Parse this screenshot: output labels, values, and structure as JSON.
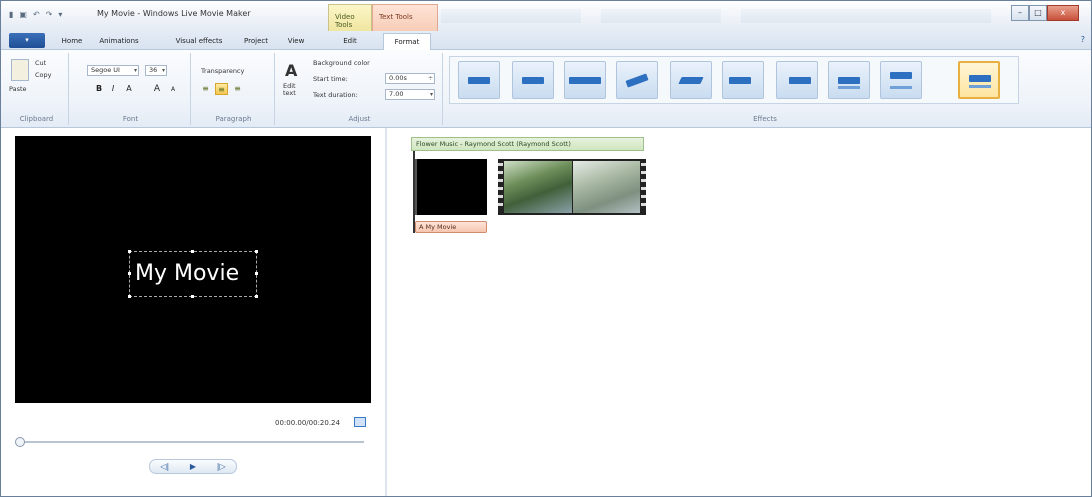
{
  "window": {
    "title": "My Movie - Windows Live Movie Maker",
    "context_tabs": {
      "video_tools": "Video Tools",
      "text_tools": "Text Tools"
    },
    "controls": {
      "minimize": "–",
      "maximize": "□",
      "close": "x"
    }
  },
  "tabs": {
    "file": "",
    "items": [
      {
        "label": "Home"
      },
      {
        "label": "Animations"
      },
      {
        "label": "Visual effects"
      },
      {
        "label": "Project"
      },
      {
        "label": "View"
      },
      {
        "label": "Edit"
      },
      {
        "label": "Format",
        "active": true
      }
    ],
    "help": "?"
  },
  "ribbon": {
    "clipboard": {
      "paste": "Paste",
      "cut": "Cut",
      "copy": "Copy",
      "label": "Clipboard"
    },
    "font": {
      "family": "Segoe UI",
      "size": "36",
      "label": "Font",
      "bold": "B",
      "italic": "I",
      "grow": "A",
      "shrink": "A"
    },
    "paragraph": {
      "transparency": "Transparency",
      "label": "Paragraph"
    },
    "adjust": {
      "background_color": "Background color",
      "start_time_label": "Start time:",
      "start_time_value": "0.00s",
      "text_duration_label": "Text duration:",
      "text_duration_value": "7.00",
      "edit_text": "Edit text",
      "label": "Adjust"
    },
    "effects": {
      "label": "Effects",
      "count": 13,
      "selected_index": 12
    }
  },
  "preview": {
    "title_text": "My Movie",
    "timecode": "00:00.00/00:20.24"
  },
  "storyboard": {
    "music_label": "Flower Music - Raymond Scott (Raymond Scott)",
    "caption_label": "A My Movie"
  },
  "colors": {
    "accent": "#2d6fc0",
    "preview_bg": "#000000",
    "music_bar": "#cfe6c0",
    "caption_bar": "#f6c5b0",
    "selected_effect": "#e8b040"
  }
}
